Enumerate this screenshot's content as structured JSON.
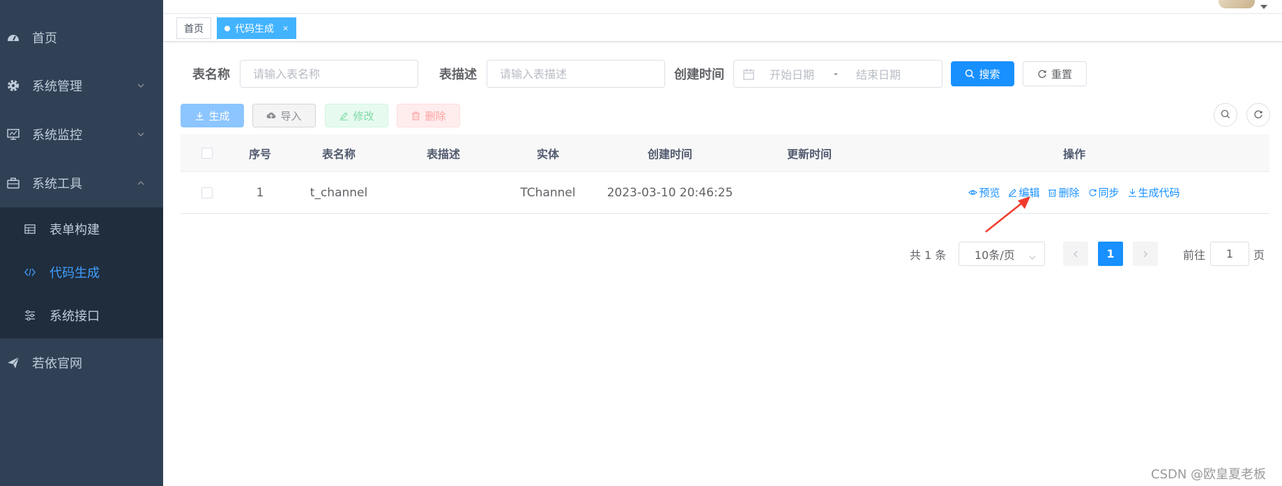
{
  "sidebar": {
    "bg": "#304156",
    "items": [
      {
        "label": "首页",
        "icon": "dashboard-icon"
      },
      {
        "label": "系统管理",
        "icon": "gear-icon"
      },
      {
        "label": "系统监控",
        "icon": "monitor-icon"
      },
      {
        "label": "系统工具",
        "icon": "toolbox-icon"
      },
      {
        "label": "若依官网",
        "icon": "paper-plane-icon"
      }
    ],
    "subitems": [
      {
        "label": "表单构建",
        "icon": "table-icon"
      },
      {
        "label": "代码生成",
        "icon": "code-icon",
        "active": true
      },
      {
        "label": "系统接口",
        "icon": "sliders-icon"
      }
    ]
  },
  "tags": {
    "home": "首页",
    "current": "代码生成",
    "close": "×"
  },
  "search": {
    "table_name_label": "表名称",
    "table_name_placeholder": "请输入表名称",
    "table_desc_label": "表描述",
    "table_desc_placeholder": "请输入表描述",
    "create_time_label": "创建时间",
    "start_placeholder": "开始日期",
    "separator": "-",
    "end_placeholder": "结束日期",
    "search_btn": "搜索",
    "reset_btn": "重置"
  },
  "toolbar": {
    "generate": "生成",
    "import": "导入",
    "edit": "修改",
    "delete": "删除"
  },
  "table": {
    "columns": [
      "序号",
      "表名称",
      "表描述",
      "实体",
      "创建时间",
      "更新时间",
      "操作"
    ],
    "rows": [
      {
        "index": "1",
        "table_name": "t_channel",
        "table_desc": "",
        "entity": "TChannel",
        "create_time": "2023-03-10 20:46:25",
        "update_time": ""
      }
    ],
    "actions": {
      "preview": "预览",
      "edit": "编辑",
      "delete": "删除",
      "sync": "同步",
      "gen_code": "生成代码"
    }
  },
  "pagination": {
    "total": "共 1 条",
    "page_size": "10条/页",
    "current": "1",
    "goto_label": "前往",
    "goto_value": "1",
    "page_suffix": "页"
  },
  "watermark": "CSDN @欧皇夏老板",
  "colors": {
    "primary": "#1890ff",
    "sidebar_active": "#409eff",
    "annotation_arrow": "#f03a2e"
  }
}
